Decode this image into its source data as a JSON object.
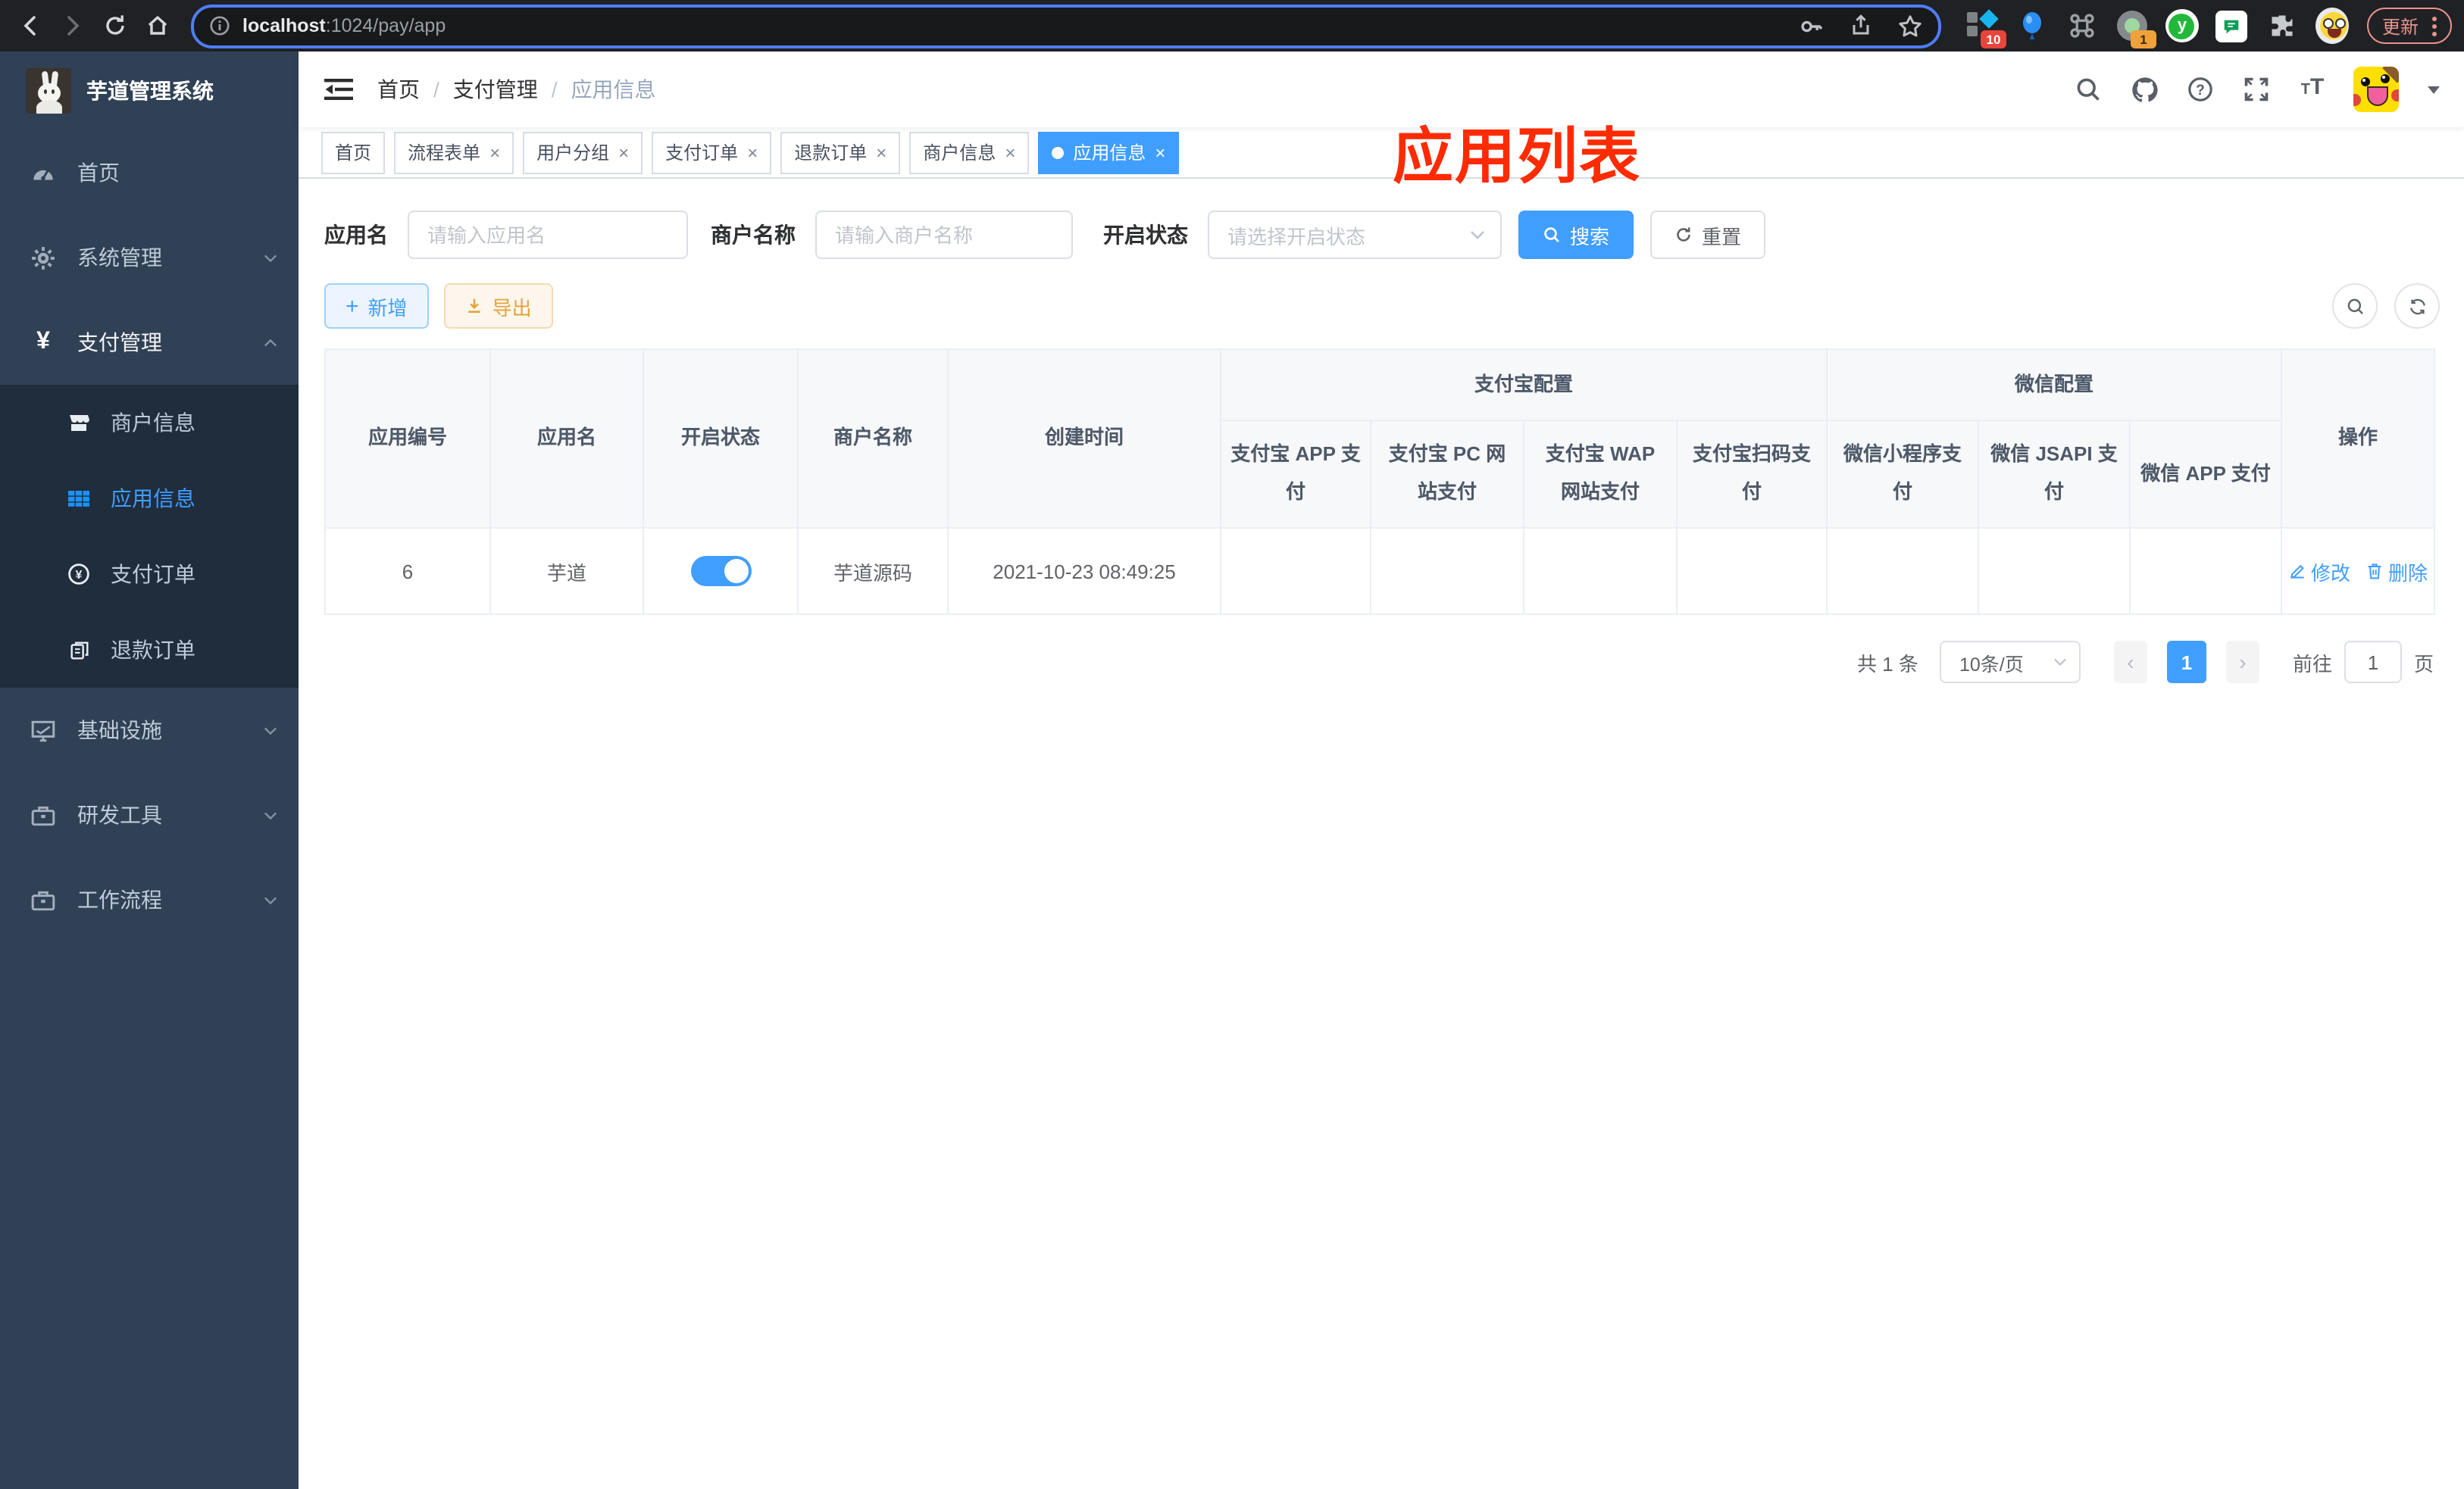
{
  "colors": {
    "accent": "#409eff",
    "success": "#13ce66",
    "danger": "#f8514a",
    "annotation": "#fe2b00",
    "sidebar_bg": "#304156",
    "submenu_bg": "#1f2d3d"
  },
  "browser": {
    "url_host": "localhost",
    "url_rest": ":1024/pay/app",
    "ext_badge_blue": "10",
    "ext_badge_rec": "1",
    "y_ext_letter": "y",
    "update_label": "更新"
  },
  "sidebar": {
    "title": "芋道管理系统",
    "home": "首页",
    "system": "系统管理",
    "pay": "支付管理",
    "merchant_info": "商户信息",
    "app_info": "应用信息",
    "pay_order": "支付订单",
    "refund_order": "退款订单",
    "infra": "基础设施",
    "dev_tools": "研发工具",
    "workflow": "工作流程"
  },
  "header": {
    "breadcrumb": {
      "home": "首页",
      "pay": "支付管理",
      "app": "应用信息"
    },
    "annotation": "应用列表"
  },
  "tabs": {
    "t0": "首页",
    "t1": "流程表单",
    "t2": "用户分组",
    "t3": "支付订单",
    "t4": "退款订单",
    "t5": "商户信息",
    "t6": "应用信息",
    "close": "×"
  },
  "filters": {
    "app_name_label": "应用名",
    "app_name_placeholder": "请输入应用名",
    "merchant_label": "商户名称",
    "merchant_placeholder": "请输入商户名称",
    "status_label": "开启状态",
    "status_placeholder": "请选择开启状态",
    "search": "搜索",
    "reset": "重置"
  },
  "toolbar": {
    "add": "新增",
    "export": "导出",
    "plus": "+"
  },
  "table": {
    "headers": {
      "app_id": "应用编号",
      "app_name": "应用名",
      "status": "开启状态",
      "merchant": "商户名称",
      "created": "创建时间",
      "alipay_group": "支付宝配置",
      "wechat_group": "微信配置",
      "actions": "操作",
      "alipay_app": "支付宝 APP 支付",
      "alipay_pc": "支付宝 PC 网站支付",
      "alipay_wap": "支付宝 WAP 网站支付",
      "alipay_qr": "支付宝扫码支付",
      "wx_mini": "微信小程序支付",
      "wx_jsapi": "微信 JSAPI 支付",
      "wx_app": "微信 APP 支付"
    },
    "row": {
      "id": "6",
      "name": "芋道",
      "merchant": "芋道源码",
      "created": "2021-10-23 08:49:25",
      "statuses": [
        "no",
        "no",
        "no",
        "no",
        "no",
        "ok",
        "no"
      ],
      "edit": "修改",
      "delete": "删除"
    }
  },
  "pagination": {
    "total": "共 1 条",
    "page_size": "10条/页",
    "prev": "‹",
    "page": "1",
    "next": "›",
    "goto": "前往",
    "goto_value": "1",
    "page_unit": "页"
  }
}
